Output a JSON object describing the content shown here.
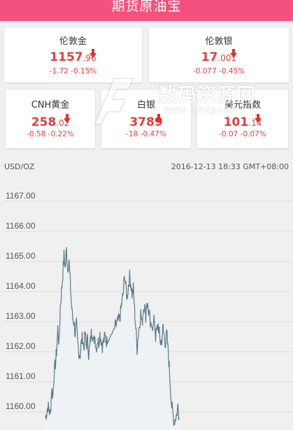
{
  "header": {
    "title": "期货原油宝"
  },
  "cards": [
    {
      "name": "伦敦金",
      "price_main": "1157",
      "price_dec": ".96",
      "change": "-1.72",
      "percent": "-0.15%"
    },
    {
      "name": "伦敦银",
      "price_main": "17",
      "price_dec": ".001",
      "change": "-0.077",
      "percent": "-0.45%"
    },
    {
      "name": "CNH黄金",
      "price_main": "258",
      "price_dec": ".02",
      "change": "-0.58",
      "percent": "-0.22%"
    },
    {
      "name": "白银",
      "price_main": "3789",
      "price_dec": "",
      "change": "-18",
      "percent": "-0.47%"
    },
    {
      "name": "美元指数",
      "price_main": "101",
      "price_dec": ".14",
      "change": "-0.07",
      "percent": "-0.07%"
    }
  ],
  "watermark": {
    "text": "数码资源网",
    "url": "www.smzy.com"
  },
  "chart_info": {
    "unit": "USD/OZ",
    "timestamp": "2016-12-13 18:33 GMT+08:00"
  },
  "colors": {
    "header": "#f4527e",
    "down": "#e04040",
    "line": "#5e7a86",
    "fill": "#eef2f4"
  },
  "chart_data": {
    "type": "line",
    "ylabels": [
      "1167.00",
      "1166.00",
      "1165.00",
      "1164.00",
      "1163.00",
      "1162.00",
      "1161.00",
      "1160.00"
    ],
    "ylim": [
      1159.7,
      1167.3
    ],
    "grid": true,
    "points": [
      [
        0,
        1159.8
      ],
      [
        0.01,
        1160.2
      ],
      [
        0.02,
        1159.9
      ],
      [
        0.025,
        1160.8
      ],
      [
        0.03,
        1160.5
      ],
      [
        0.035,
        1161.3
      ],
      [
        0.04,
        1161.6
      ],
      [
        0.045,
        1162.0
      ],
      [
        0.05,
        1162.8
      ],
      [
        0.055,
        1162.2
      ],
      [
        0.06,
        1163.5
      ],
      [
        0.065,
        1164.0
      ],
      [
        0.07,
        1164.6
      ],
      [
        0.075,
        1165.2
      ],
      [
        0.08,
        1164.8
      ],
      [
        0.085,
        1165.4
      ],
      [
        0.09,
        1164.7
      ],
      [
        0.095,
        1165.1
      ],
      [
        0.1,
        1164.3
      ],
      [
        0.105,
        1163.6
      ],
      [
        0.11,
        1163.1
      ],
      [
        0.115,
        1163.0
      ],
      [
        0.12,
        1162.6
      ],
      [
        0.125,
        1162.9
      ],
      [
        0.13,
        1162.3
      ],
      [
        0.135,
        1162.0
      ],
      [
        0.14,
        1161.9
      ],
      [
        0.145,
        1162.3
      ],
      [
        0.15,
        1162.5
      ],
      [
        0.155,
        1162.1
      ],
      [
        0.16,
        1162.6
      ],
      [
        0.165,
        1162.2
      ],
      [
        0.17,
        1162.4
      ],
      [
        0.175,
        1161.9
      ],
      [
        0.18,
        1162.2
      ],
      [
        0.185,
        1162.6
      ],
      [
        0.19,
        1162.7
      ],
      [
        0.195,
        1162.3
      ],
      [
        0.2,
        1162.5
      ],
      [
        0.205,
        1162.1
      ],
      [
        0.21,
        1162.4
      ],
      [
        0.215,
        1162.3
      ],
      [
        0.22,
        1162.6
      ],
      [
        0.225,
        1162.4
      ],
      [
        0.23,
        1162.2
      ],
      [
        0.24,
        1162.5
      ],
      [
        0.25,
        1162.3
      ],
      [
        0.28,
        1162.8
      ],
      [
        0.3,
        1163.1
      ],
      [
        0.31,
        1163.7
      ],
      [
        0.315,
        1164.0
      ],
      [
        0.32,
        1164.6
      ],
      [
        0.325,
        1164.1
      ],
      [
        0.33,
        1163.8
      ],
      [
        0.335,
        1164.2
      ],
      [
        0.34,
        1164.5
      ],
      [
        0.345,
        1164.3
      ],
      [
        0.35,
        1163.9
      ],
      [
        0.355,
        1164.1
      ],
      [
        0.36,
        1163.4
      ],
      [
        0.365,
        1162.8
      ],
      [
        0.37,
        1162.1
      ],
      [
        0.375,
        1162.6
      ],
      [
        0.38,
        1162.9
      ],
      [
        0.385,
        1163.3
      ],
      [
        0.39,
        1162.9
      ],
      [
        0.395,
        1163.4
      ],
      [
        0.4,
        1163.6
      ],
      [
        0.405,
        1163.2
      ],
      [
        0.41,
        1163.7
      ],
      [
        0.415,
        1163.4
      ],
      [
        0.42,
        1163.2
      ],
      [
        0.425,
        1162.7
      ],
      [
        0.43,
        1163.0
      ],
      [
        0.435,
        1162.8
      ],
      [
        0.44,
        1163.1
      ],
      [
        0.445,
        1162.5
      ],
      [
        0.45,
        1162.7
      ],
      [
        0.455,
        1162.9
      ],
      [
        0.46,
        1162.6
      ],
      [
        0.465,
        1162.3
      ],
      [
        0.47,
        1162.4
      ],
      [
        0.475,
        1162.8
      ],
      [
        0.48,
        1162.5
      ],
      [
        0.485,
        1162.3
      ],
      [
        0.49,
        1162.6
      ],
      [
        0.495,
        1162.1
      ],
      [
        0.5,
        1161.5
      ],
      [
        0.505,
        1160.8
      ],
      [
        0.51,
        1160.2
      ],
      [
        0.515,
        1159.9
      ],
      [
        0.52,
        1159.7
      ],
      [
        0.53,
        1159.9
      ],
      [
        0.535,
        1160.2
      ],
      [
        0.54,
        1159.8
      ]
    ]
  }
}
